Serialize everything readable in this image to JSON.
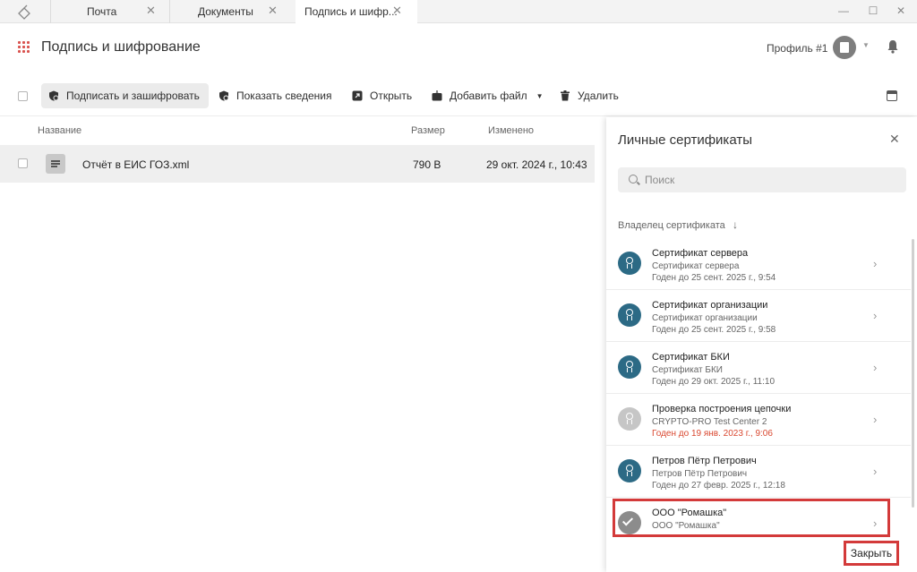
{
  "tabs": [
    {
      "label": "Почта"
    },
    {
      "label": "Документы"
    },
    {
      "label": "Подпись и шифр..."
    }
  ],
  "header": {
    "title": "Подпись и шифрование",
    "profile_label": "Профиль #1"
  },
  "toolbar": {
    "sign_encrypt": "Подписать и зашифровать",
    "show_details": "Показать сведения",
    "open": "Открыть",
    "add_file": "Добавить файл",
    "delete": "Удалить"
  },
  "file_list": {
    "columns": {
      "name": "Название",
      "size": "Размер",
      "modified": "Изменено"
    },
    "rows": [
      {
        "name": "Отчёт в ЕИС ГОЗ.xml",
        "size": "790 B",
        "modified": "29 окт. 2024 г., 10:43"
      }
    ]
  },
  "panel": {
    "title": "Личные сертификаты",
    "search_placeholder": "Поиск",
    "sort_label": "Владелец сертификата",
    "certificates": [
      {
        "name": "Сертификат сервера",
        "subject": "Сертификат сервера",
        "valid": "Годен до 25 сент. 2025 г., 9:54",
        "expired": false
      },
      {
        "name": "Сертификат организации",
        "subject": "Сертификат организации",
        "valid": "Годен до 25 сент. 2025 г., 9:58",
        "expired": false
      },
      {
        "name": "Сертификат БКИ",
        "subject": "Сертификат БКИ",
        "valid": "Годен до 29 окт. 2025 г., 11:10",
        "expired": false
      },
      {
        "name": "Проверка построения цепочки",
        "subject": "CRYPTO-PRO Test Center 2",
        "valid": "Годен до 19 янв. 2023 г., 9:06",
        "expired": true
      },
      {
        "name": "Петров Пётр Петрович",
        "subject": "Петров Пётр Петрович",
        "valid": "Годен до 27 февр. 2025 г., 12:18",
        "expired": false
      },
      {
        "name": "ООО \"Ромашка\"",
        "subject": "ООО \"Ромашка\"",
        "valid": "",
        "expired": false
      }
    ],
    "close_button": "Закрыть"
  },
  "colors": {
    "cert_accent": "#2c6a85",
    "expired_text": "#d9472f",
    "highlight_border": "#d33a3a",
    "apps_grid": "#d9534f"
  }
}
